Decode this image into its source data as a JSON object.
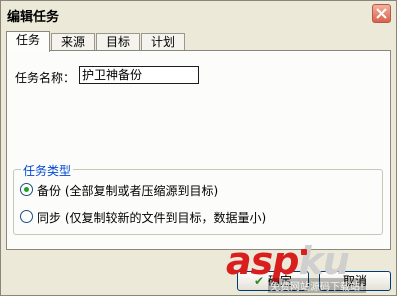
{
  "window": {
    "title": "编辑任务"
  },
  "tabs": [
    {
      "label": "任务",
      "active": true
    },
    {
      "label": "来源",
      "active": false
    },
    {
      "label": "目标",
      "active": false
    },
    {
      "label": "计划",
      "active": false
    }
  ],
  "form": {
    "name_label": "任务名称：",
    "name_value": "护卫神备份"
  },
  "task_type": {
    "title": "任务类型",
    "options": [
      {
        "label": "备份 (全部复制或者压缩源到目标)",
        "selected": true
      },
      {
        "label": "同步 (仅复制较新的文件到目标，数据量小)",
        "selected": false
      }
    ]
  },
  "buttons": {
    "ok_label": "确定",
    "cancel_label": "取消"
  },
  "watermark": {
    "logo_asp": "asp",
    "logo_ku": "ku",
    "tagline": "免费网站源码下载站!"
  },
  "colors": {
    "dialog_bg": "#ece9d8",
    "group_title": "#0046d5",
    "logo_red": "#d91e1e",
    "radio_selected": "#21a121"
  }
}
